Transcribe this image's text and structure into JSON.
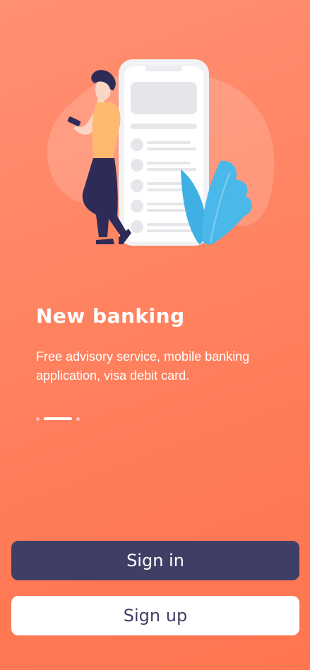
{
  "onboarding": {
    "title": "New banking",
    "description": "Free advisory service, mobile banking application, visa debit card.",
    "pager": {
      "total": 3,
      "active_index": 1
    }
  },
  "actions": {
    "sign_in_label": "Sign in",
    "sign_up_label": "Sign up"
  },
  "colors": {
    "background": "#ff8462",
    "primary_button": "#3f3f66",
    "secondary_button": "#ffffff",
    "text_on_primary": "#ffffff",
    "text_on_secondary": "#3f3f66",
    "illustration_leaf": "#4ab8e8",
    "illustration_shirt": "#ffb870",
    "illustration_pants": "#2e2c57"
  },
  "icons": {
    "illustration": "person-with-phone-illustration"
  }
}
